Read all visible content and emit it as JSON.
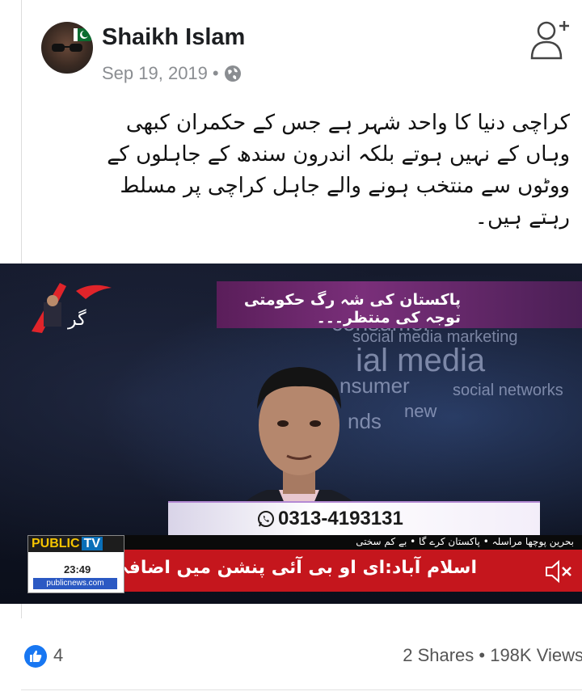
{
  "post": {
    "author": "Shaikh Islam",
    "date": "Sep 19, 2019",
    "separator": "•",
    "privacy_icon": "globe-icon",
    "text_lines": [
      "کراچی دنیا کا واحد شہر ہے جس کے حکمران کبھی",
      "وہاں کے نہیں ہوتے بلکہ اندرون سندھ کے جاہلوں کے",
      "ووٹوں سے منتخب ہونے والے جاہل کراچی پر مسلط",
      "رہتے ہیں۔"
    ]
  },
  "video": {
    "banner_text": "پاکستان کی شہ رگ حکومتی توجہ کی منتظر۔۔۔",
    "screen_words": [
      "consumer",
      "social media marketing",
      "ial media",
      "nsumer",
      "social networks",
      "new",
      "nds"
    ],
    "phone": "0313-4193131",
    "ticker_top": "بحرین پوچھا مراسلہ • پاکستان کرے گا • بے کم سختی",
    "ticker_main": "اسلام آباد:ای او بی آئی پنشن میں اضافہ کر دیا گیا",
    "channel_name": "PUBLIC",
    "channel_tv": "TV",
    "channel_time": "23:49",
    "channel_site": "publicnews.com",
    "mute_icon": "speaker-mute-icon"
  },
  "stats": {
    "like_icon": "thumbs-up-icon",
    "likes": "4",
    "shares_views": "2 Shares • 198K Views"
  },
  "colors": {
    "ticker_red": "#c5161d",
    "banner_purple": "#7a2f7a",
    "like_blue": "#1877f2"
  }
}
